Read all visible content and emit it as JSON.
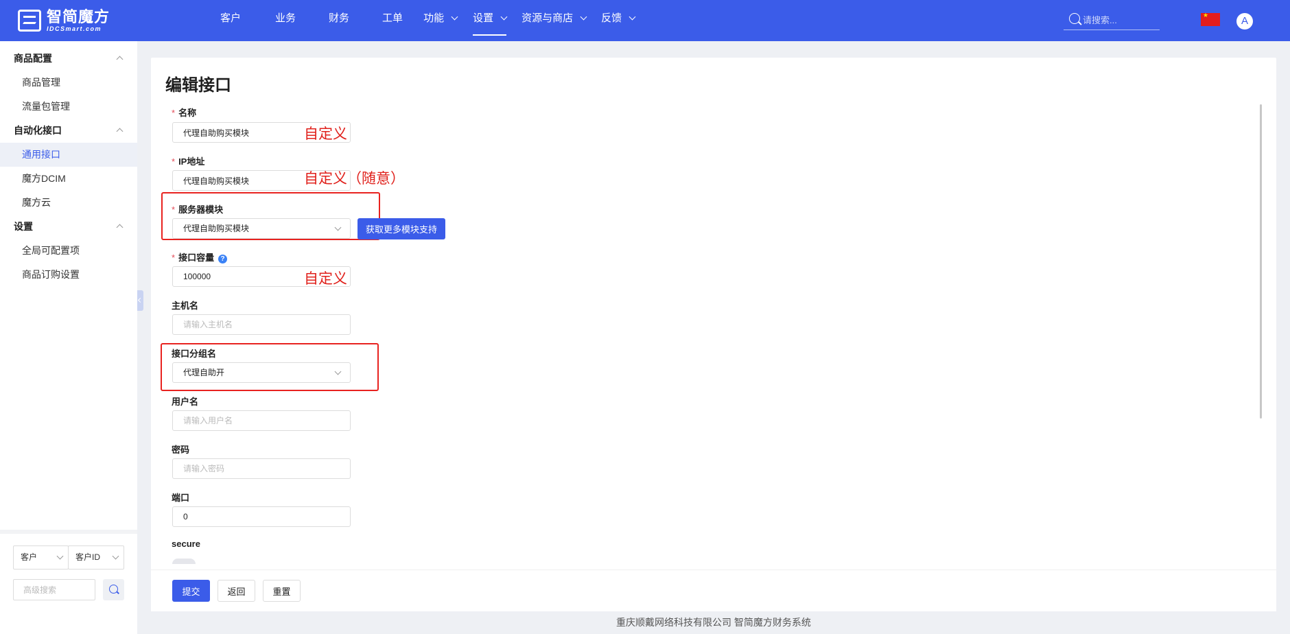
{
  "header": {
    "logo_cn": "智简魔方",
    "logo_en": "IDCSmart.com",
    "nav": [
      {
        "label": "客户",
        "dropdown": false
      },
      {
        "label": "业务",
        "dropdown": false
      },
      {
        "label": "财务",
        "dropdown": false
      },
      {
        "label": "工单",
        "dropdown": false
      },
      {
        "label": "功能",
        "dropdown": true
      },
      {
        "label": "设置",
        "dropdown": true,
        "active": true
      },
      {
        "label": "资源与商店",
        "dropdown": true
      },
      {
        "label": "反馈",
        "dropdown": true
      }
    ],
    "search_placeholder": "请搜索...",
    "avatar_letter": "A"
  },
  "sidebar": {
    "groups": [
      {
        "label": "商品配置",
        "items": [
          "商品管理",
          "流量包管理"
        ]
      },
      {
        "label": "自动化接口",
        "items": [
          "通用接口",
          "魔方DCIM",
          "魔方云"
        ]
      },
      {
        "label": "设置",
        "items": [
          "全局可配置项",
          "商品订购设置"
        ]
      }
    ],
    "active_item": "通用接口",
    "filter_type": "客户",
    "filter_field": "客户ID",
    "advanced_search_placeholder": "高级搜索"
  },
  "form": {
    "title": "编辑接口",
    "fields": {
      "name": {
        "label": "名称",
        "value": "代理自助购买模块",
        "required": true
      },
      "ip": {
        "label": "IP地址",
        "value": "代理自助购买模块",
        "required": true
      },
      "module": {
        "label": "服务器模块",
        "value": "代理自助购买模块",
        "required": true
      },
      "capacity": {
        "label": "接口容量",
        "value": "100000",
        "required": true
      },
      "hostname": {
        "label": "主机名",
        "placeholder": "请输入主机名"
      },
      "group": {
        "label": "接口分组名",
        "value": "代理自助开"
      },
      "username": {
        "label": "用户名",
        "placeholder": "请输入用户名"
      },
      "password": {
        "label": "密码",
        "placeholder": "请输入密码"
      },
      "port": {
        "label": "端口",
        "value": "0"
      },
      "secure": {
        "label": "secure"
      }
    },
    "more_modules_button": "获取更多模块支持",
    "submit_button": "提交",
    "back_button": "返回",
    "reset_button": "重置"
  },
  "annotations": {
    "name_note": "自定义",
    "ip_note": "自定义（随意）",
    "capacity_note": "自定义",
    "color": "#e0201b"
  },
  "footer": {
    "copyright": "重庆顺戴网络科技有限公司 智简魔方财务系统"
  },
  "colors": {
    "brand": "#3b5ce9",
    "required": "#e34d59"
  }
}
